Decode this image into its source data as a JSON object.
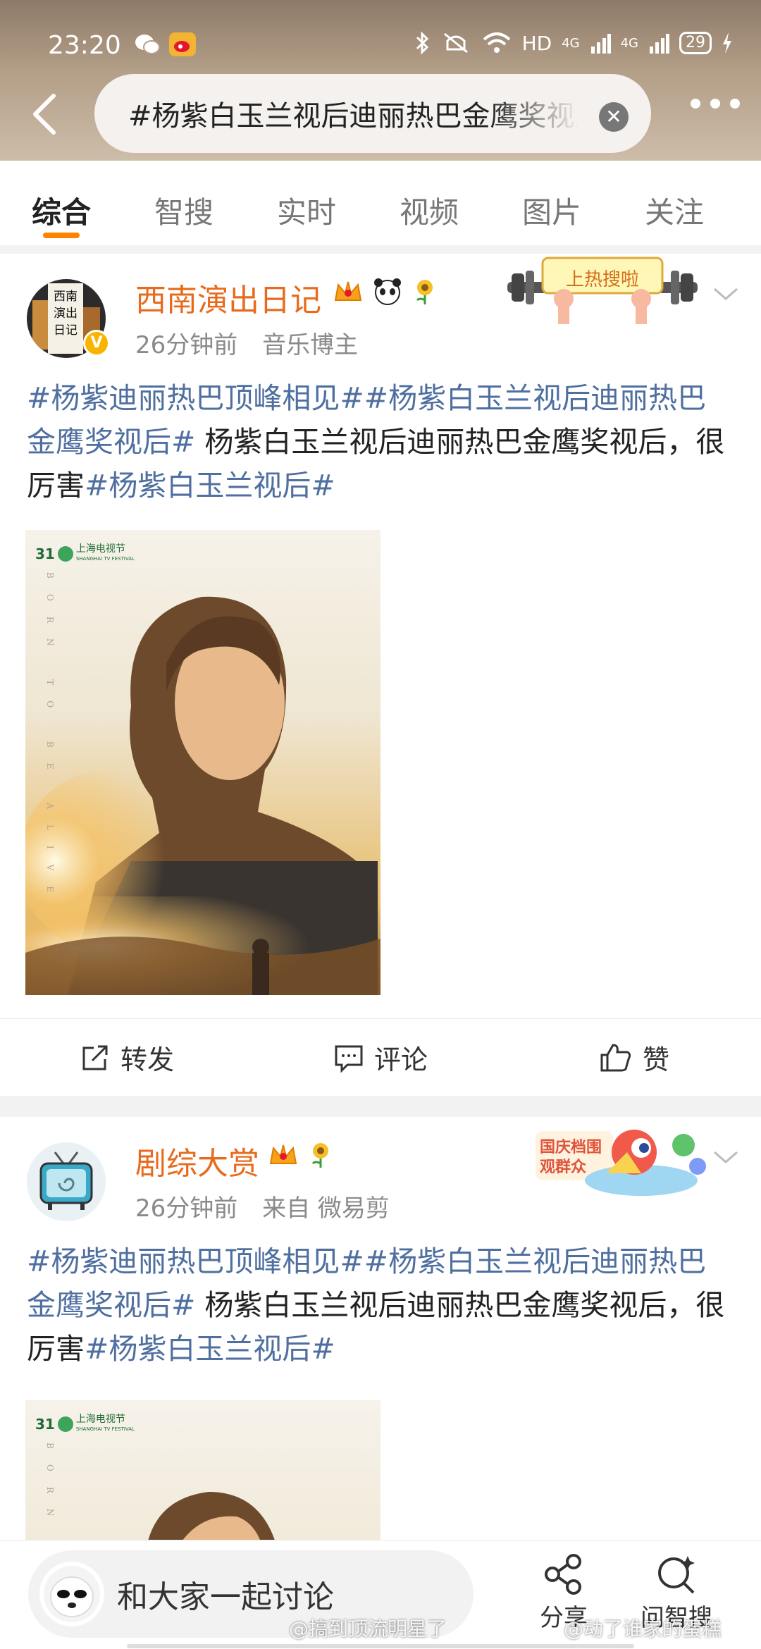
{
  "status_bar": {
    "time": "23:20",
    "network": "HD",
    "sim1": "4G",
    "sim2": "4G",
    "battery": "29"
  },
  "search": {
    "query": "#杨紫白玉兰视后迪丽热巴金鹰奖视后#",
    "clear_icon": "close-icon"
  },
  "tabs": [
    "综合",
    "智搜",
    "实时",
    "视频",
    "图片",
    "关注"
  ],
  "active_tab": 0,
  "posts": [
    {
      "username": "西南演出日记",
      "avatar_text": "西南演出日记",
      "time": "26分钟前",
      "source": "音乐博主",
      "sticker_text": "上热搜啦",
      "text_tag1": "#杨紫迪丽热巴顶峰相见#",
      "text_tag2": "#杨紫白玉兰视后迪丽热巴金鹰奖视后#",
      "text_body": " 杨紫白玉兰视后迪丽热巴金鹰奖视后，很厉害",
      "text_tag3": "#杨紫白玉兰视后#",
      "photo_logo_num": "31",
      "photo_logo_name": "上海电视节",
      "photo_logo_sub": "SHANGHAI TV FESTIVAL",
      "photo_vertical_text": "BORN TO BE ALIVE",
      "actions": {
        "repost": "转发",
        "comment": "评论",
        "like": "赞"
      }
    },
    {
      "username": "剧综大赏",
      "time": "26分钟前",
      "source": "来自 微易剪",
      "sticker_text": "国庆档围观群众",
      "text_tag1": "#杨紫迪丽热巴顶峰相见#",
      "text_tag2": "#杨紫白玉兰视后迪丽热巴金鹰奖视后#",
      "text_body": " 杨紫白玉兰视后迪丽热巴金鹰奖视后，很厉害",
      "text_tag3": "#杨紫白玉兰视后#",
      "photo_logo_num": "31",
      "photo_logo_name": "上海电视节",
      "photo_logo_sub": "SHANGHAI TV FESTIVAL",
      "photo_vertical_text": "BORN"
    }
  ],
  "bottom_bar": {
    "discuss_placeholder": "和大家一起讨论",
    "share_label": "分享",
    "ask_label": "问智搜"
  },
  "watermarks": [
    "@搞到顶流明星了",
    "@动了谁家的蛋糕"
  ],
  "colors": {
    "accent": "#ff8200",
    "username": "#e86b1d",
    "hashtag": "#4f6fa0"
  }
}
